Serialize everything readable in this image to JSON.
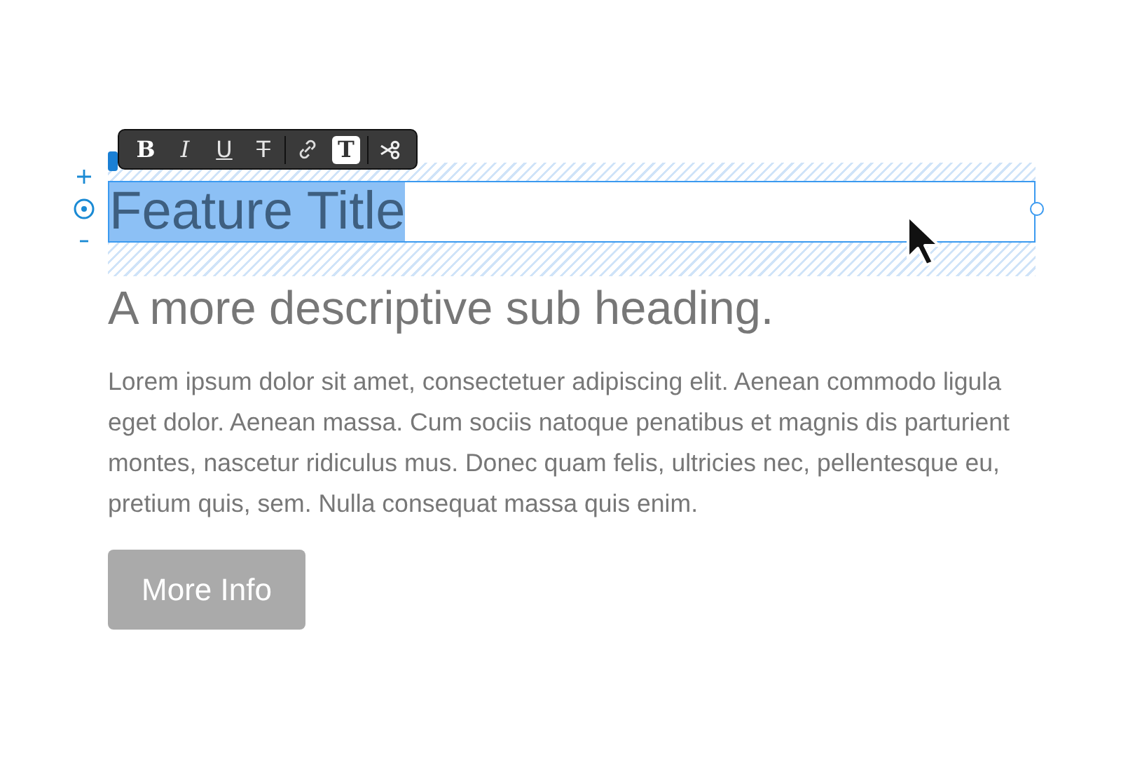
{
  "toolbar": {
    "buttons": [
      {
        "kind": "bold",
        "label": "B",
        "selected": false
      },
      {
        "kind": "italic",
        "label": "I",
        "selected": false
      },
      {
        "kind": "underline",
        "label": "U",
        "selected": false
      },
      {
        "kind": "strike",
        "label": "T",
        "selected": false
      },
      {
        "kind": "link",
        "selected": false
      },
      {
        "kind": "text",
        "label": "T",
        "selected": true
      },
      {
        "kind": "cut",
        "selected": false
      }
    ]
  },
  "title": {
    "text": "Feature Title",
    "selected": true
  },
  "subheading": "A more descriptive sub heading.",
  "paragraph": "Lorem ipsum dolor sit amet, consectetuer adipiscing elit. Aenean commodo ligula eget dolor. Aenean massa. Cum sociis natoque penatibus et magnis dis parturient montes, nascetur ridiculus mus. Donec quam felis, ultricies nec, pellentesque eu, pretium quis, sem. Nulla consequat massa quis enim.",
  "button": "More Info"
}
